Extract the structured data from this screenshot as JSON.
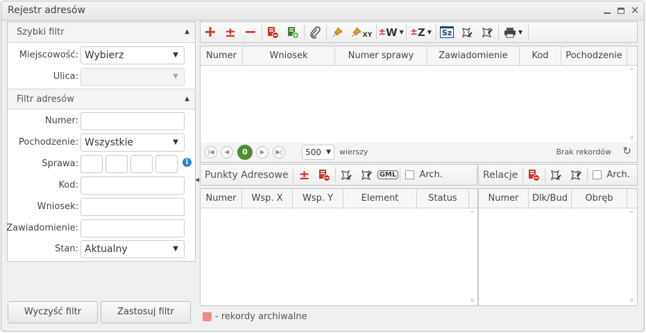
{
  "window": {
    "title": "Rejestr adresów",
    "controls": {
      "minimize": "minimize-icon",
      "maximize": "maximize-icon",
      "close": "close-icon"
    }
  },
  "quick_filter": {
    "title": "Szybki filtr",
    "city_label": "Miejscowość:",
    "city_value": "Wybierz",
    "street_label": "Ulica:",
    "street_value": ""
  },
  "address_filter": {
    "title": "Filtr adresów",
    "number_label": "Numer:",
    "origin_label": "Pochodzenie:",
    "origin_value": "Wszystkie",
    "case_label": "Sprawa:",
    "code_label": "Kod:",
    "application_label": "Wniosek:",
    "notification_label": "Zawiadomienie:",
    "state_label": "Stan:",
    "state_value": "Aktualny"
  },
  "buttons": {
    "clear": "Wyczyść filtr",
    "apply": "Zastosuj filtr"
  },
  "main_grid": {
    "columns": [
      "Numer",
      "Wniosek",
      "Numer sprawy",
      "Zawiadomienie",
      "Kod",
      "Pochodzenie"
    ],
    "rows": []
  },
  "toolbar_icons": [
    "add-icon",
    "add-remove-icon",
    "remove-icon",
    "delete-record-icon",
    "add-record-icon",
    "attachment-icon",
    "pin-icon",
    "pin-xy-icon",
    "sort-w-icon",
    "sort-z-icon",
    "sz-icon",
    "edit-geometry-icon",
    "edit-geometry-alt-icon",
    "print-icon"
  ],
  "toolbar_text": {
    "sort_w": "W",
    "sort_z": "Z",
    "sz": "Sz",
    "pin_xy": "XY"
  },
  "pager": {
    "current_page": "0",
    "page_size": "500",
    "rows_label": "wierszy",
    "status": "Brak rekordów"
  },
  "points_panel": {
    "title": "Punkty Adresowe",
    "archive_label": "Arch.",
    "gml_label": "GML",
    "columns": [
      "Numer",
      "Wsp. X",
      "Wsp. Y",
      "Element",
      "Status"
    ]
  },
  "relations_panel": {
    "title": "Relacje",
    "archive_label": "Arch.",
    "columns": [
      "Numer",
      "Dlk/Bud",
      "Obręb"
    ]
  },
  "legend": {
    "text": "- rekordy archiwalne",
    "color": "#f08a8a"
  },
  "colors": {
    "accent_red": "#d12b1f",
    "accent_green": "#3c9a2d",
    "pager_current": "#4d8f2f",
    "info": "#2a85c8"
  }
}
